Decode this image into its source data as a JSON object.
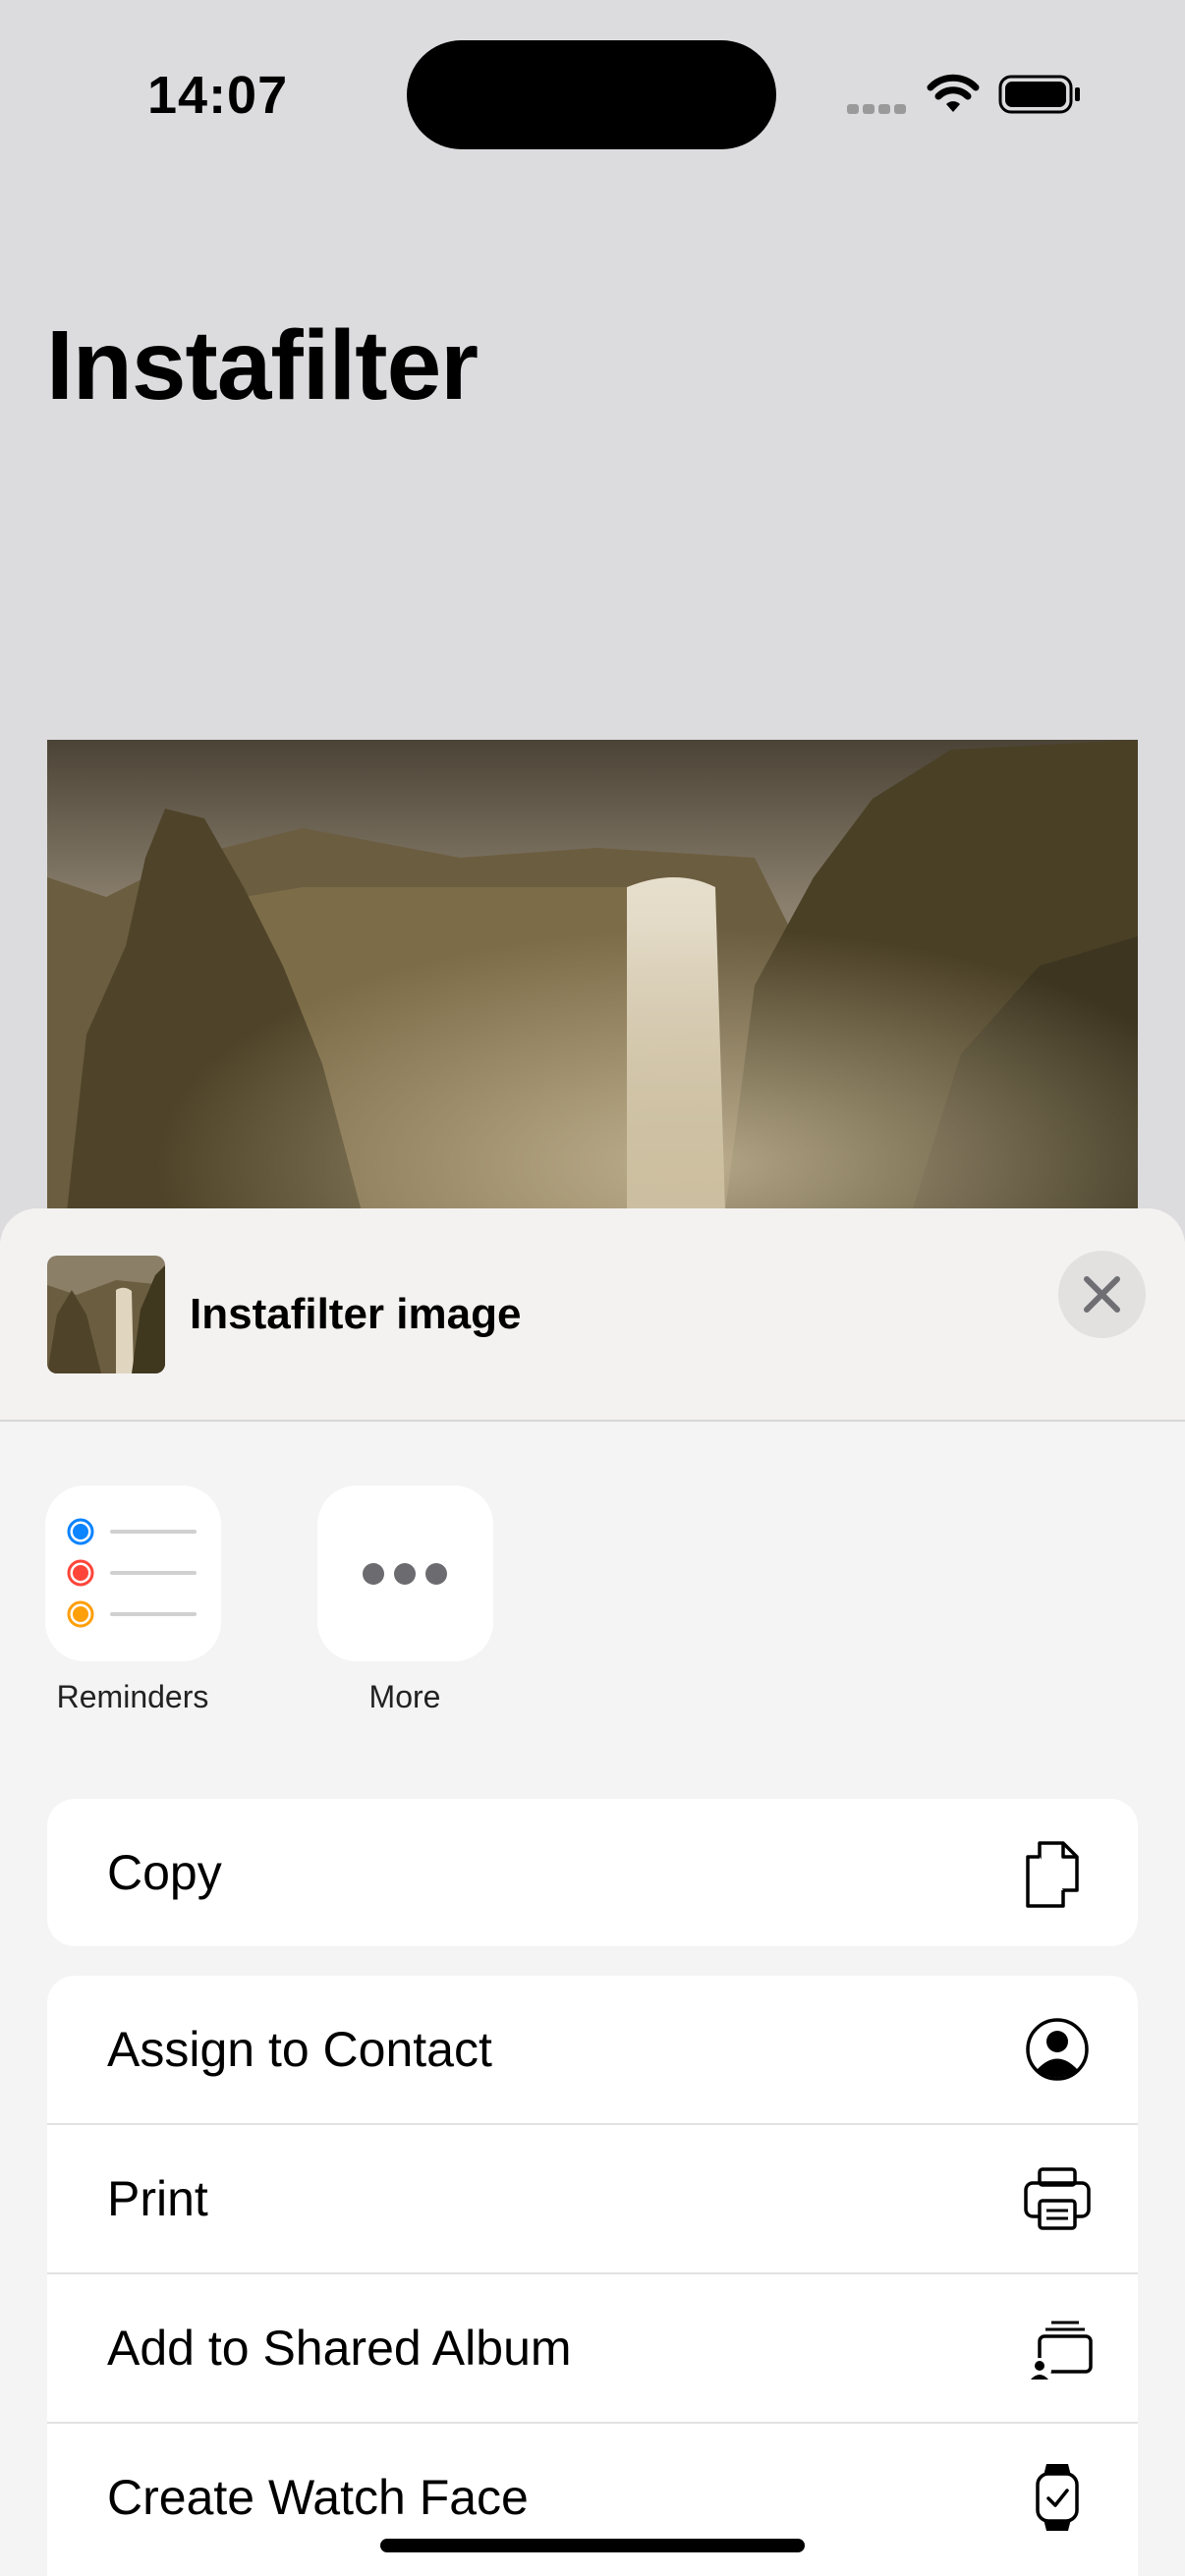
{
  "status_bar": {
    "time": "14:07"
  },
  "nav": {
    "title": "Instafilter"
  },
  "share_sheet": {
    "title": "Instafilter image",
    "apps": [
      {
        "label": "Reminders",
        "icon": "reminders-icon"
      },
      {
        "label": "More",
        "icon": "more-icon"
      }
    ],
    "actions_primary": [
      {
        "label": "Copy",
        "icon": "copy-icon"
      }
    ],
    "actions_secondary": [
      {
        "label": "Assign to Contact",
        "icon": "person-circle-icon"
      },
      {
        "label": "Print",
        "icon": "printer-icon"
      },
      {
        "label": "Add to Shared Album",
        "icon": "shared-album-icon"
      },
      {
        "label": "Create Watch Face",
        "icon": "watch-icon"
      }
    ]
  },
  "colors": {
    "background": "#dcdcde",
    "sheet": "#f4f4f4",
    "reminder_blue": "#0a84ff",
    "reminder_red": "#ff453a",
    "reminder_orange": "#ff9f0a"
  }
}
